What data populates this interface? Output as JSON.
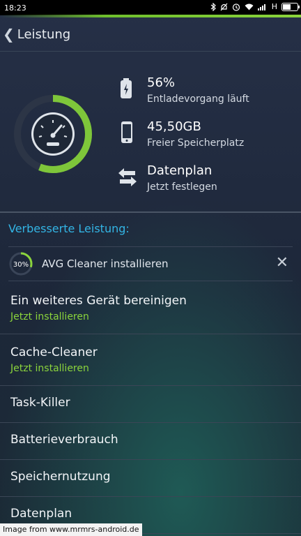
{
  "status_bar": {
    "time": "18:23",
    "network": "H",
    "battery_level": 0.56,
    "icons": [
      "bluetooth-icon",
      "mute-icon",
      "alarm-icon",
      "wifi-icon",
      "signal-icon",
      "battery-icon"
    ]
  },
  "app_bar": {
    "back_glyph": "❮",
    "title": "Leistung"
  },
  "hero": {
    "gauge_progress": 0.56,
    "stats": [
      {
        "value": "56%",
        "subtitle": "Entladevorgang läuft",
        "icon": "battery-icon"
      },
      {
        "value": "45,50GB",
        "subtitle": "Freier Speicherplatz",
        "icon": "phone-icon"
      },
      {
        "value": "Datenplan",
        "subtitle": "Jetzt festlegen",
        "icon": "data-transfer-icon"
      }
    ]
  },
  "section": {
    "title": "Verbesserte Leistung:"
  },
  "promo": {
    "percent": "30%",
    "progress": 0.3,
    "label": "AVG Cleaner installieren",
    "close_glyph": "✕"
  },
  "list": [
    {
      "name": "Ein weiteres Gerät bereinigen",
      "sub": "Jetzt installieren"
    },
    {
      "name": "Cache-Cleaner",
      "sub": "Jetzt installieren"
    },
    {
      "name": "Task-Killer"
    },
    {
      "name": "Batterieverbrauch"
    },
    {
      "name": "Speichernutzung"
    },
    {
      "name": "Datenplan"
    }
  ],
  "colors": {
    "accent_green": "#8bd43c",
    "accent_blue": "#33b5e5",
    "background": "#1d2739"
  },
  "watermark": "Image from www.mrmrs-android.de"
}
